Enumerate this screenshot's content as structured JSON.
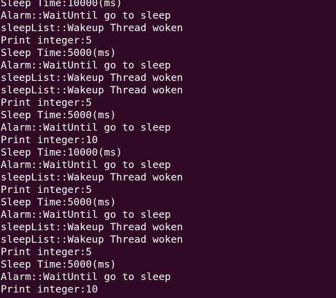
{
  "terminal": {
    "background": "#300a24",
    "foreground": "#ffffff",
    "lines": [
      "Sleep Time:10000(ms)",
      "Alarm::WaitUntil go to sleep",
      "sleepList::Wakeup Thread woken",
      "Print integer:5",
      "Sleep Time:5000(ms)",
      "Alarm::WaitUntil go to sleep",
      "sleepList::Wakeup Thread woken",
      "sleepList::Wakeup Thread woken",
      "Print integer:5",
      "Sleep Time:5000(ms)",
      "Alarm::WaitUntil go to sleep",
      "Print integer:10",
      "Sleep Time:10000(ms)",
      "Alarm::WaitUntil go to sleep",
      "sleepList::Wakeup Thread woken",
      "Print integer:5",
      "Sleep Time:5000(ms)",
      "Alarm::WaitUntil go to sleep",
      "sleepList::Wakeup Thread woken",
      "sleepList::Wakeup Thread woken",
      "Print integer:5",
      "Sleep Time:5000(ms)",
      "Alarm::WaitUntil go to sleep",
      "Print integer:10"
    ]
  }
}
